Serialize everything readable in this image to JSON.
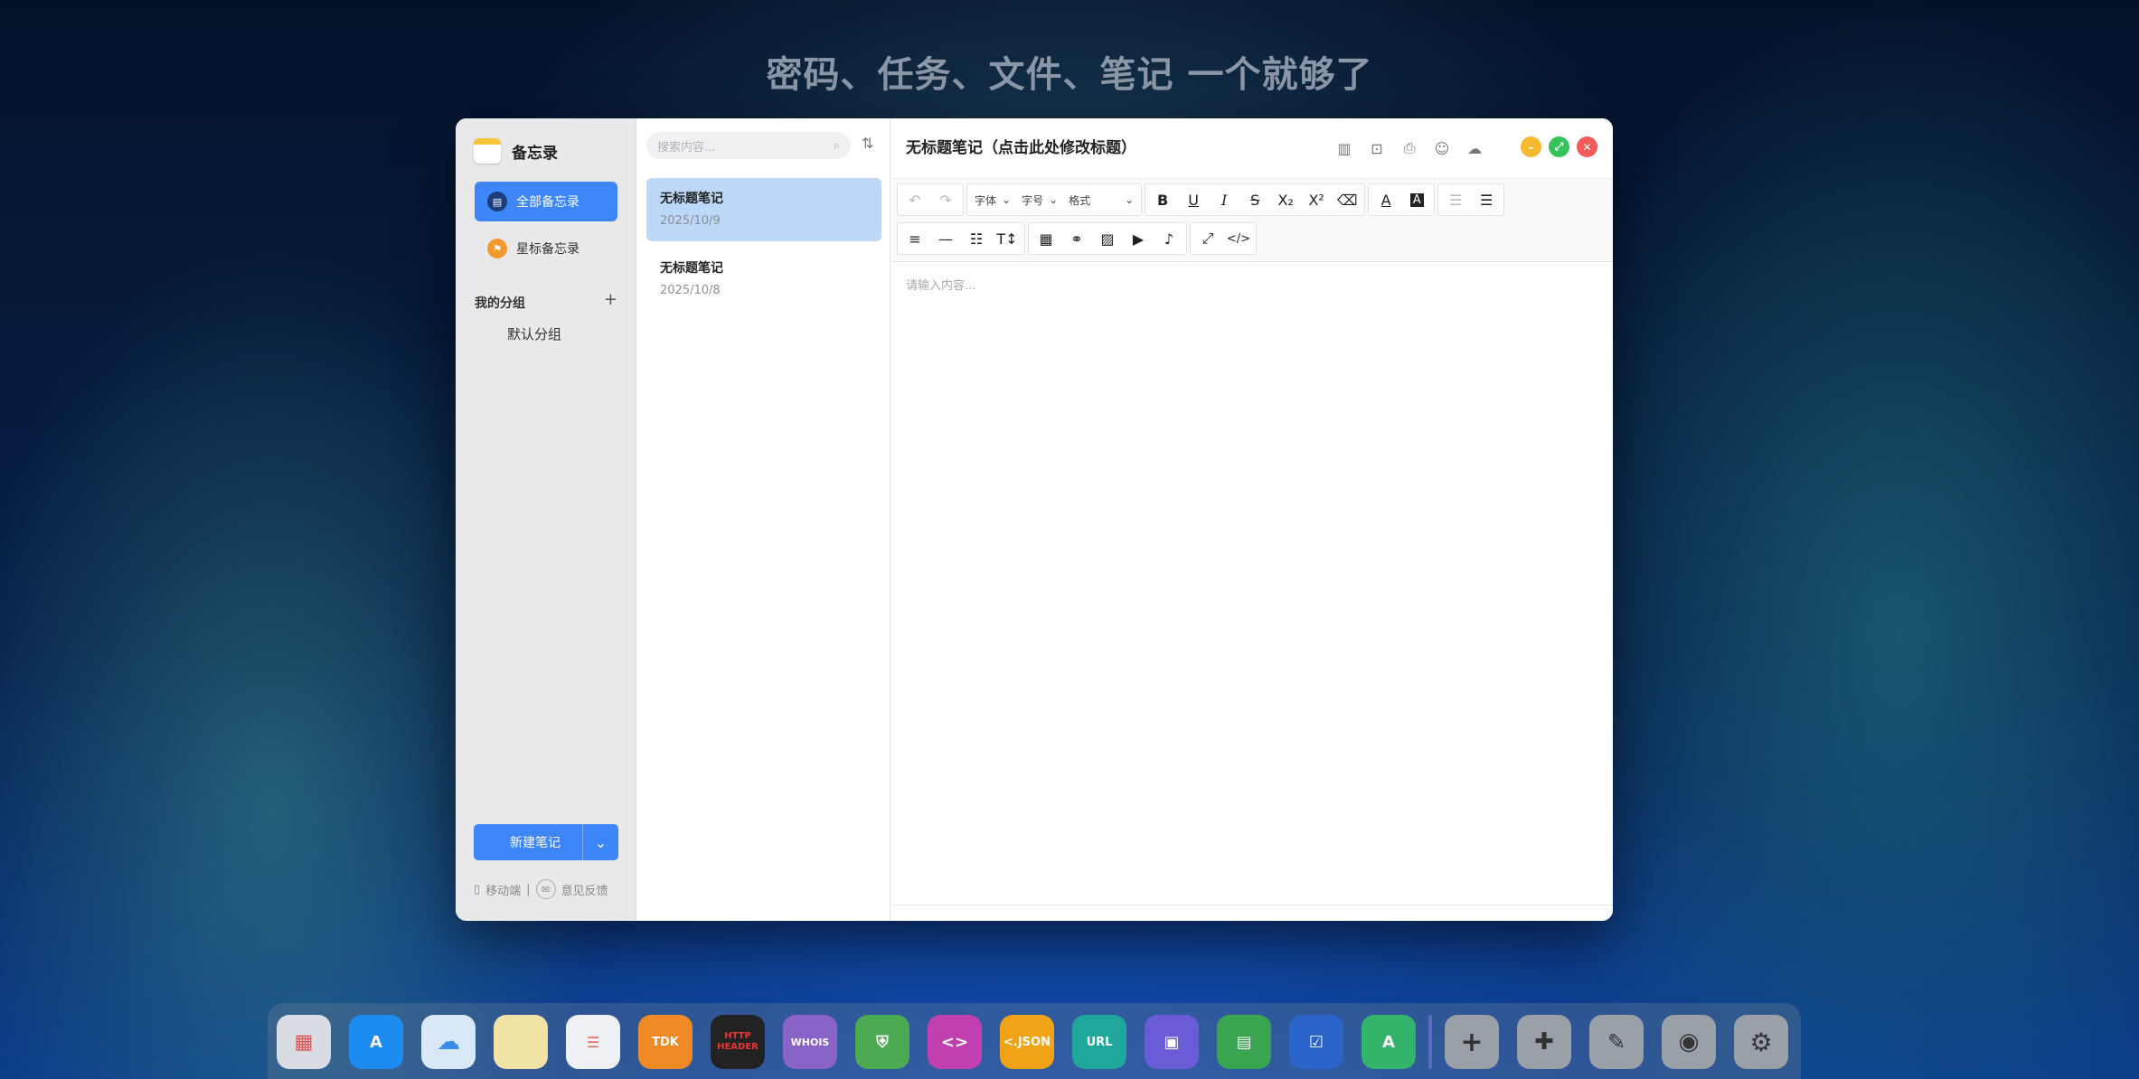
{
  "headline": "密码、任务、文件、笔记 一个就够了",
  "sidebar": {
    "app_title": "备忘录",
    "nav": [
      {
        "label": "全部备忘录",
        "icon": "notes-icon"
      },
      {
        "label": "星标备忘录",
        "icon": "flag-icon"
      }
    ],
    "group_header": "我的分组",
    "group_add": "+",
    "groups": [
      "默认分组"
    ],
    "new_note": "新建笔记",
    "mobile": "移动端",
    "separator": "|",
    "feedback": "意见反馈"
  },
  "list": {
    "search_placeholder": "搜索内容...",
    "notes": [
      {
        "title": "无标题笔记",
        "date": "2025/10/9"
      },
      {
        "title": "无标题笔记",
        "date": "2025/10/8"
      }
    ]
  },
  "editor": {
    "title": "无标题笔记（点击此处修改标题）",
    "font_select": "字体",
    "size_select": "字号",
    "format_select": "格式",
    "placeholder": "请输入内容..."
  },
  "dock": {
    "labels": [
      "TDK",
      "HTTP HEADER",
      "WHOIS",
      "<.JSON",
      "URL"
    ]
  },
  "colors": {
    "accent": "#3d86f7",
    "selected_card": "#bcd7f7",
    "minimize": "#f5b82e",
    "maximize": "#35c45a",
    "close": "#f35b5b"
  }
}
